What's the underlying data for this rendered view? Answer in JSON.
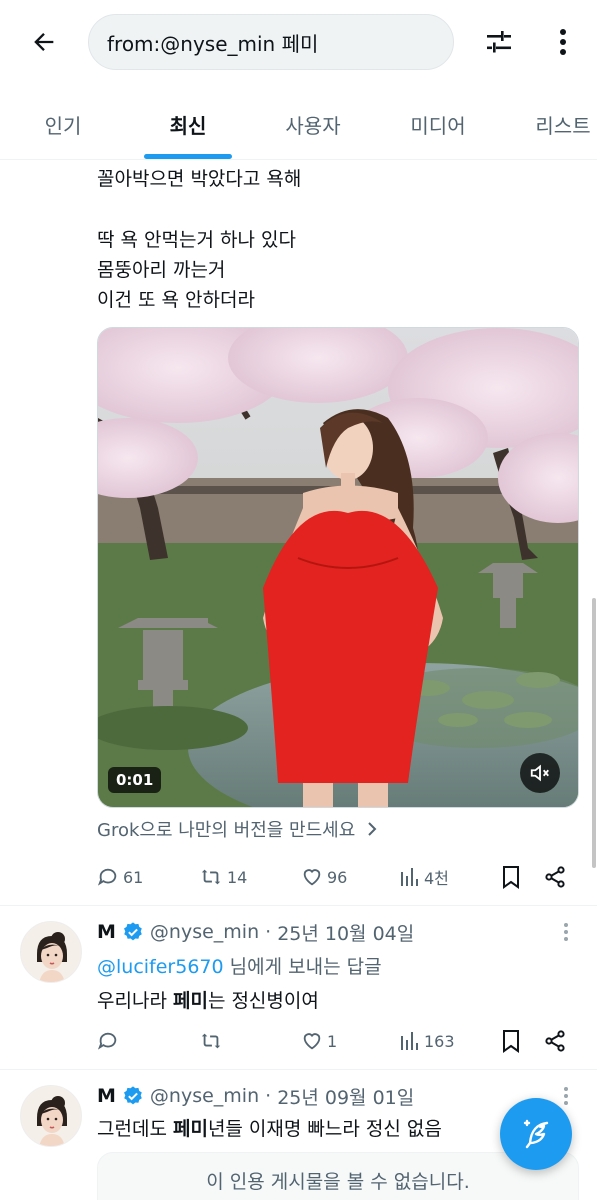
{
  "search": {
    "query": "from:@nyse_min 페미"
  },
  "tabs": [
    {
      "label": "인기",
      "active": false
    },
    {
      "label": "최신",
      "active": true
    },
    {
      "label": "사용자",
      "active": false
    },
    {
      "label": "미디어",
      "active": false
    },
    {
      "label": "리스트",
      "active": false
    }
  ],
  "tweet": {
    "lines": [
      "꼴아박으면 박았다고 욕해",
      "딱 욕 안먹는거 하나 있다",
      "몸뚱아리 까는거",
      "이건 또 욕 안하더라"
    ],
    "video_duration": "0:01",
    "grok_link": "Grok으로 나만의 버전을 만드세요",
    "stats": {
      "replies": "61",
      "retweets": "14",
      "likes": "96",
      "views": "4천"
    }
  },
  "replies": [
    {
      "name": "M",
      "handle": "@nyse_min",
      "separator": "·",
      "date": "25년 10월 04일",
      "mention": "@lucifer5670",
      "reply_to_suffix": " 님에게 보내는 답글",
      "text_before": "우리나라 ",
      "text_bold": "페미",
      "text_after": "는 정신병이여",
      "stats": {
        "replies": "",
        "retweets": "",
        "likes": "1",
        "views": "163"
      }
    },
    {
      "name": "M",
      "handle": "@nyse_min",
      "separator": "·",
      "date": "25년 09월 01일",
      "text_before": "그런데도 ",
      "text_bold": "페미",
      "text_after": "년들 이재명 빠느라 정신 없음",
      "quote_unavailable": "이 인용 게시물을 볼 수 없습니다."
    }
  ],
  "colors": {
    "accent": "#1d9bf0",
    "text_primary": "#0f1419",
    "text_secondary": "#536471",
    "divider": "#eff3f4"
  },
  "icons": {
    "back": "arrow-left-icon",
    "filter": "sliders-icon",
    "more": "vertical-dots-icon",
    "reply": "speech-bubble-icon",
    "retweet": "retweet-icon",
    "like": "heart-icon",
    "views": "bar-chart-icon",
    "bookmark": "bookmark-icon",
    "share": "share-icon",
    "verified": "verified-badge-icon",
    "mute": "speaker-muted-icon",
    "compose": "feather-plus-icon"
  }
}
